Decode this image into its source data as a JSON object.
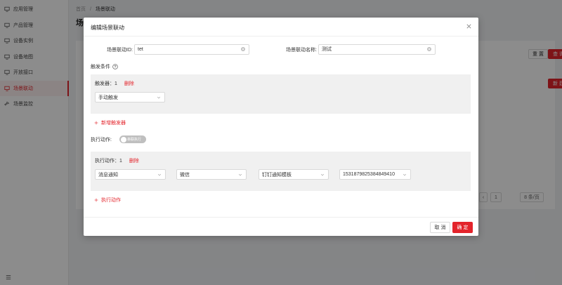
{
  "sidebar": {
    "items": [
      {
        "label": "应用管理",
        "icon": "computer-icon"
      },
      {
        "label": "产品管理",
        "icon": "computer-icon"
      },
      {
        "label": "设备实例",
        "icon": "computer-icon"
      },
      {
        "label": "设备地图",
        "icon": "computer-icon"
      },
      {
        "label": "开放接口",
        "icon": "computer-icon"
      },
      {
        "label": "场景联动",
        "icon": "computer-icon",
        "active": true
      },
      {
        "label": "场景监控",
        "icon": "link-icon"
      }
    ]
  },
  "breadcrumb": {
    "home": "首页",
    "sep": "/",
    "current": "场景联动"
  },
  "page_title": "场",
  "background_buttons": {
    "reset": "重 置",
    "search": "查 询",
    "new": "新 建"
  },
  "pagination": {
    "page": "1",
    "page_size": "8 条/页"
  },
  "modal": {
    "title": "编辑场景联动",
    "id_label": "场景联动ID:",
    "id_value": "tet",
    "name_label": "场景联动名称:",
    "name_value": "测试",
    "trigger_section": "触发条件",
    "trigger_box": {
      "head": "触发器：1",
      "delete": "删除",
      "select": "手动触发"
    },
    "add_trigger": "新增触发器",
    "action_label": "执行动作:",
    "parallel_toggle": "串联执行",
    "action_box": {
      "head": "执行动作：1",
      "delete": "删除",
      "selects": [
        "消息通知",
        "微信",
        "钉钉通知模板",
        "1531879825384849410"
      ]
    },
    "add_action": "执行动作",
    "cancel": "取 消",
    "ok": "确 定"
  },
  "colors": {
    "accent": "#e3242b"
  }
}
